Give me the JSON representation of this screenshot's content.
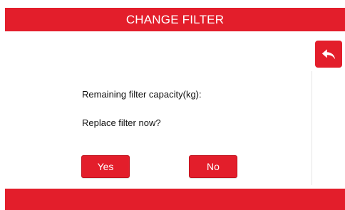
{
  "header": {
    "title": "CHANGE FILTER"
  },
  "back_button": {
    "icon": "back-arrow-icon"
  },
  "message": {
    "capacity_label": "Remaining filter capacity(kg):",
    "question": "Replace filter now?"
  },
  "buttons": {
    "yes_label": "Yes",
    "no_label": "No"
  },
  "colors": {
    "accent": "#e31e2b",
    "text": "#111111",
    "background": "#ffffff"
  }
}
